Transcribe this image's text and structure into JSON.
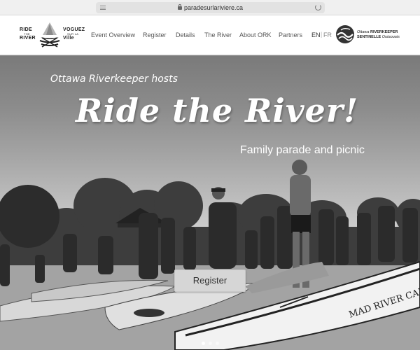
{
  "browser": {
    "url": "paradesurlariviere.ca",
    "icons": [
      "reader-icon",
      "lock-icon",
      "reload-icon"
    ]
  },
  "logo": {
    "left_line1": "RIDE",
    "left_line2": "THE",
    "left_line3": "RIVER",
    "right_line1": "VOGUEZ",
    "right_line2": "SUR LA",
    "right_line3": "Ville"
  },
  "nav": {
    "items": [
      {
        "label": "Event Overview"
      },
      {
        "label": "Register"
      },
      {
        "label": "Details"
      },
      {
        "label": "The River"
      },
      {
        "label": "About ORK"
      },
      {
        "label": "Partners"
      }
    ],
    "lang_en": "EN",
    "lang_sep": "|",
    "lang_fr": "FR"
  },
  "ork": {
    "line1_italic": "Ottawa",
    "line1_bold": "RIVERKEEPER",
    "line2_bold": "SENTINELLE",
    "line2_italic": "Outaouais"
  },
  "hero": {
    "kicker": "Ottawa Riverkeeper hosts",
    "title": "Ride the River!",
    "subtitle": "Family parade and picnic",
    "cta_label": "Register",
    "canoe_text": "MAD RIVER CANOE",
    "slide_dots": 3,
    "active_dot": 0
  },
  "colors": {
    "nav_text": "#555555",
    "hero_text": "#ffffff",
    "button_bg": "#d6d6d6"
  }
}
